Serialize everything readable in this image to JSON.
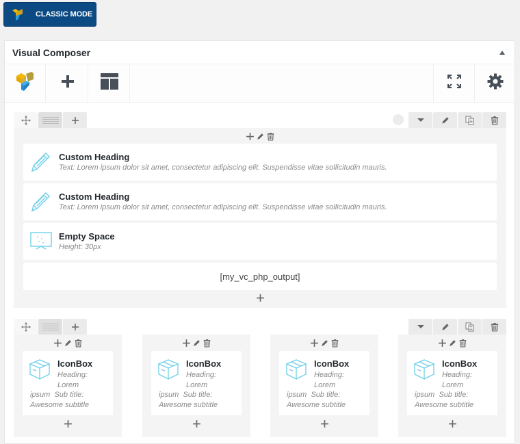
{
  "classic_mode_button": {
    "label": "CLASSIC MODE",
    "icon": "vc-logo-icon"
  },
  "panel": {
    "title": "Visual Composer",
    "collapse_icon": "triangle-up-icon"
  },
  "toolbar": {
    "left": [
      {
        "name": "vc-logo",
        "icon": "vc-logo-icon"
      },
      {
        "name": "add-element",
        "icon": "plus-icon"
      },
      {
        "name": "templates",
        "icon": "layout-template-icon"
      }
    ],
    "right": [
      {
        "name": "fullscreen",
        "icon": "fullscreen-icon"
      },
      {
        "name": "settings",
        "icon": "gear-icon"
      }
    ]
  },
  "colors": {
    "brand_blue": "#0b4a82",
    "icon_blue": "#6fcfe8",
    "icon_dark": "#555d66",
    "row_bg": "#f4f4f4"
  },
  "rows": [
    {
      "controls_left": [
        "move-icon",
        "column-layout-icon",
        "plus-icon"
      ],
      "controls_right": [
        "color-dot",
        "chevron-down-icon",
        "pencil-icon",
        "copy-icon",
        "trash-icon"
      ],
      "column_controls": [
        "plus-icon",
        "pencil-icon",
        "trash-icon"
      ],
      "elements": [
        {
          "type": "custom-heading",
          "title": "Custom Heading",
          "subtitle": "Text: Lorem ipsum dolor sit amet, consectetur adipiscing elit. Suspendisse vitae sollicitudin mauris."
        },
        {
          "type": "custom-heading",
          "title": "Custom Heading",
          "subtitle": "Text: Lorem ipsum dolor sit amet, consectetur adipiscing elit. Suspendisse vitae sollicitudin mauris."
        },
        {
          "type": "empty-space",
          "title": "Empty Space",
          "subtitle": "Height: 30px"
        },
        {
          "type": "shortcode",
          "text": "[my_vc_php_output]"
        }
      ]
    },
    {
      "controls_left": [
        "move-icon",
        "column-layout-icon",
        "plus-icon"
      ],
      "controls_right": [
        "chevron-down-icon",
        "pencil-icon",
        "copy-icon",
        "trash-icon"
      ],
      "columns": [
        {
          "title": "IconBox",
          "line1": "Heading:",
          "line2": "Lorem",
          "line3": "ipsum  Sub title:",
          "line4": "Awesome subtitle"
        },
        {
          "title": "IconBox",
          "line1": "Heading:",
          "line2": "Lorem",
          "line3": "ipsum  Sub title:",
          "line4": "Awesome subtitle"
        },
        {
          "title": "IconBox",
          "line1": "Heading:",
          "line2": "Lorem",
          "line3": "ipsum  Sub title:",
          "line4": "Awesome subtitle"
        },
        {
          "title": "IconBox",
          "line1": "Heading:",
          "line2": "Lorem",
          "line3": "ipsum  Sub title:",
          "line4": "Awesome subtitle"
        }
      ]
    }
  ]
}
